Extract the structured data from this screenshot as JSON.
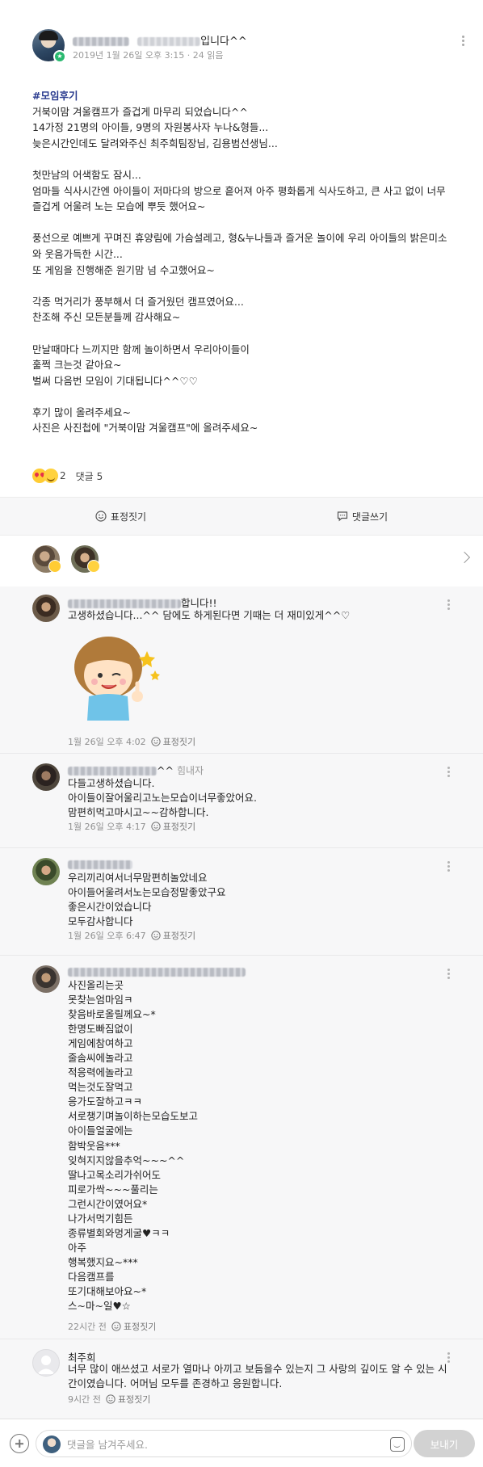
{
  "post": {
    "author_suffix": "입니다^^",
    "date": "2019년 1월 26일 오후 3:15",
    "separator": "·",
    "read_count": "24 읽음",
    "hashtag": "#모임후기",
    "body": "거북이맘 겨울캠프가 즐겁게 마무리 되었습니다^^\n14가정 21명의 아이들, 9명의 자원봉사자 누나&형들...\n늦은시간인데도 달려와주신 최주희팀장님, 김용범선생님...\n\n첫만남의 어색함도 잠시...\n엄마들 식사시간엔 아이들이 저마다의 방으로 흩어져 아주 평화롭게 식사도하고, 큰 사고 없이 너무 즐겁게 어울려 노는 모습에 뿌듯 했어요~\n\n풍선으로 예쁘게 꾸며진 휴양림에 가슴설레고, 형&누나들과 즐거운 놀이에 우리 아이들의 밝은미소와 웃음가득한 시간...\n또 게임을 진행해준 원기맘 넘 수고했어요~\n\n각종 먹거리가 풍부해서 더 즐거웠던 캠프였어요...\n찬조해 주신 모든분들께 감사해요~\n\n만날때마다 느끼지만 함께 놀이하면서 우리아이들이\n훌쩍 크는것 같아요~\n벌써 다음번 모임이 기대됩니다^^♡♡\n\n후기 많이 올려주세요~\n사진은 사진첩에 \"거북이맘 겨울캠프\"에 올려주세요~",
    "reaction_count": "2",
    "comment_label": "댓글",
    "comment_count": "5"
  },
  "actions": {
    "react_label": "표정짓기",
    "comment_label": "댓글쓰기"
  },
  "comments": [
    {
      "name_suffix": "합니다!!",
      "role": "",
      "text": "고생하셨습니다...^^ 담에도 하게된다면 기때는 더 재미있게^^♡",
      "time": "1월 26일 오후 4:02",
      "react_label": "표정짓기"
    },
    {
      "name_suffix": "^^",
      "role": "힘내자",
      "text": "다들고생하셨습니다.\n아이들이잘어울리고노는모습이너무좋았어요.\n맘편히먹고마시고~~감하합니다.",
      "time": "1월 26일 오후 4:17",
      "react_label": "표정짓기"
    },
    {
      "name_suffix": "",
      "role": "",
      "text": "우리끼리여서너무맘편히놀았네요\n아이들어울려서노는모습정말좋았구요\n좋은시간이었습니다\n모두감사합니다",
      "time": "1월 26일 오후 6:47",
      "react_label": "표정짓기"
    },
    {
      "name_suffix": "",
      "role": "",
      "text": "사진올리는곳\n못찾는엄마임ㅋ\n찾음바로올릴께요~*\n한명도빠짐없이\n게임에참여하고\n줄솜씨에놀라고\n적응력에놀라고\n먹는것도잘먹고\n응가도잘하고ㅋㅋ\n서로챙기며놀이하는모습도보고\n아이들얼굴에는\n함박웃음***\n잊혀지지않을추억~~~^^\n딸나고목소리가쉬어도\n피로가싹~~~풀리는\n그런시간이였어요*\n나가서먹기힘든\n종류별회와멍게굴♥ㅋㅋ\n아주\n행복했지요~***\n다음캠프를\n또기대해보아요~*\n스~마~일♥☆",
      "time": "22시간 전",
      "react_label": "표정짓기"
    },
    {
      "name": "최주희",
      "role": "",
      "text": "너무 많이 애쓰셨고 서로가 열마나 아끼고 보듬을수 있는지 그 사랑의 깊이도 알 수 있는 시간이였습니다. 어머님 모두를 존경하고 응원합니다.",
      "time": "9시간 전",
      "react_label": "표정짓기"
    }
  ],
  "input": {
    "placeholder": "댓글을 남겨주세요.",
    "send_label": "보내기"
  },
  "colors": {
    "hashtag": "#2a3b8f",
    "leader_badge": "#29b96f",
    "send_button": "#d2d2d2"
  }
}
